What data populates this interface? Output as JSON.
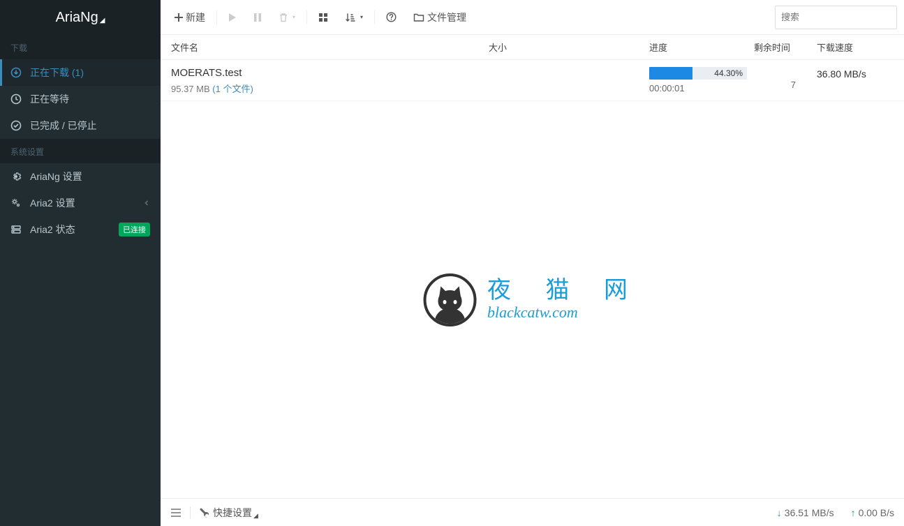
{
  "app": {
    "title": "AriaNg"
  },
  "sidebar": {
    "section_downloads": "下载",
    "section_system": "系统设置",
    "items": {
      "downloading": "正在下载 (1)",
      "waiting": "正在等待",
      "finished": "已完成 / 已停止",
      "ariang_settings": "AriaNg 设置",
      "aria2_settings": "Aria2 设置",
      "aria2_status": "Aria2 状态"
    },
    "connected_badge": "已连接"
  },
  "toolbar": {
    "new_label": "新建",
    "file_manager": "文件管理"
  },
  "search": {
    "placeholder": "搜索"
  },
  "columns": {
    "name": "文件名",
    "size": "大小",
    "progress": "进度",
    "remain": "剩余时间",
    "speed": "下载速度"
  },
  "task": {
    "name": "MOERATS.test",
    "size": "95.37 MB",
    "file_count": "(1 个文件)",
    "progress_pct": "44.30%",
    "progress_width": "44.3%",
    "elapsed": "00:00:01",
    "remain": "7",
    "speed": "36.80 MB/s"
  },
  "watermark": {
    "cn": "夜 猫 网",
    "en": "blackcatw.com"
  },
  "footer": {
    "quick_settings": "快捷设置",
    "down_speed": "36.51 MB/s",
    "up_speed": "0.00 B/s"
  }
}
